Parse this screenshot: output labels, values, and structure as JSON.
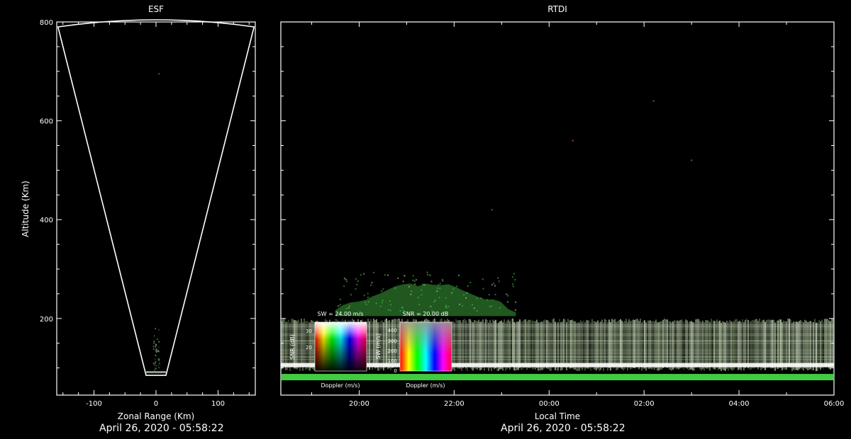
{
  "chart_data": [
    {
      "type": "heatmap",
      "title": "ESF",
      "xlabel": "Zonal Range (Km)",
      "ylabel": "Altitude (Km)",
      "xlim": [
        -160,
        160
      ],
      "ylim": [
        45,
        800
      ],
      "x_ticks": [
        -100,
        0,
        100
      ],
      "y_ticks": [
        200,
        400,
        600,
        800
      ],
      "fan_outline": {
        "apex_altitude": 85,
        "half_width_top": 158,
        "top_altitude": 800
      },
      "footer": "April 26, 2020 - 05:58:22"
    },
    {
      "type": "heatmap",
      "title": "RTDI",
      "xlabel": "Local Time",
      "ylabel": "",
      "x_ticks": [
        "20:00",
        "22:00",
        "00:00",
        "02:00",
        "04:00",
        "06:00"
      ],
      "time_range_hours": [
        18.35,
        30.0
      ],
      "ylim": [
        45,
        800
      ],
      "echo_layers": [
        {
          "name": "",
          "alt_low": 85,
          "alt_high": 200,
          "t_start": 18.35,
          "t_end": 30.0,
          "color": "#c8d0c0"
        },
        {
          "name": "",
          "alt_low": 200,
          "alt_high": 310,
          "t_start": 19.5,
          "t_end": 23.3,
          "color": "#3aa03a"
        }
      ],
      "legends": [
        {
          "title": "SW = 24.00 m/s",
          "ylabel": "SNR (dB)",
          "xlabel": "Doppler (m/s)",
          "y_ticks": [
            "30",
            "20"
          ]
        },
        {
          "title": "SNR = 20.00 dB",
          "ylabel": "SW (m/s)",
          "xlabel": "Doppler (m/s)",
          "y_ticks": [
            "400",
            "300",
            "200",
            "100",
            "0"
          ]
        }
      ],
      "footer": "April 26, 2020 - 05:58:22"
    }
  ],
  "colors": {
    "background": "#000000",
    "axes": "#ffffff",
    "echo_green": "#46d646",
    "echo_white": "#ffffff"
  }
}
